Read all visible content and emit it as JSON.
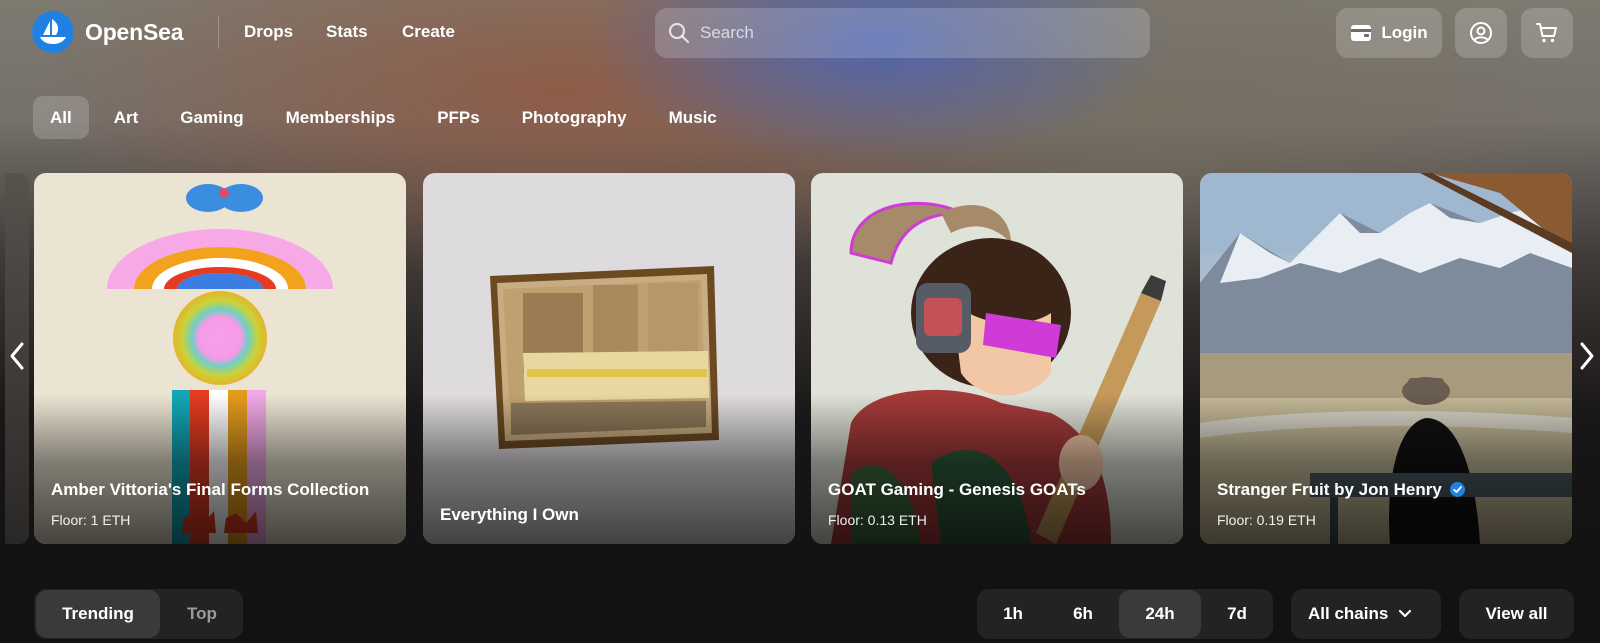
{
  "brand": {
    "name": "OpenSea",
    "color": "#2081e2"
  },
  "nav": {
    "links": [
      "Drops",
      "Stats",
      "Create"
    ]
  },
  "search": {
    "placeholder": "Search",
    "icon": "search-icon"
  },
  "header_actions": {
    "login_label": "Login",
    "login_icon": "wallet-icon",
    "profile_icon": "user-circle-icon",
    "cart_icon": "cart-icon"
  },
  "categories": {
    "items": [
      "All",
      "Art",
      "Gaming",
      "Memberships",
      "PFPs",
      "Photography",
      "Music"
    ],
    "selected": "All"
  },
  "carousel": {
    "cards": [
      {
        "title": "Amber Vittoria's Final Forms Collection",
        "floor": "Floor: 1 ETH",
        "verified": false
      },
      {
        "title": "Everything I Own",
        "floor": "",
        "verified": false
      },
      {
        "title": "GOAT Gaming - Genesis GOATs",
        "floor": "Floor: 0.13 ETH",
        "verified": false
      },
      {
        "title": "Stranger Fruit by Jon Henry",
        "floor": "Floor: 0.19 ETH",
        "verified": true
      }
    ],
    "prev_icon": "chevron-left-icon",
    "next_icon": "chevron-right-icon"
  },
  "ranking": {
    "tabs": [
      "Trending",
      "Top"
    ],
    "selected_tab": "Trending",
    "time_ranges": [
      "1h",
      "6h",
      "24h",
      "7d"
    ],
    "selected_range": "24h",
    "chains_label": "All chains",
    "view_all_label": "View all"
  },
  "colors": {
    "accent": "#2081e2",
    "background": "#121212",
    "control_bg": "#232323",
    "control_active": "#3a3a3a"
  }
}
